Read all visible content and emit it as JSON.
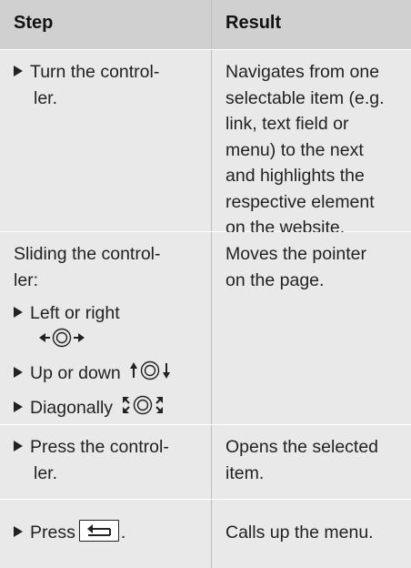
{
  "table": {
    "headers": [
      "Step",
      "Result"
    ],
    "rows": [
      {
        "step": [
          "Turn the control-",
          "ler."
        ],
        "result": [
          "Navigates from one",
          "selectable item (e.g.",
          "link, text field or",
          "menu) to the next",
          "and highlights the",
          "respective element",
          "on the website."
        ]
      },
      {
        "step_intro": [
          "Sliding the control-",
          "ler:"
        ],
        "bullets": [
          {
            "lines": [
              "Left or right"
            ],
            "icon": "left-right-slide-icon"
          },
          {
            "lines": [
              "Up or down"
            ],
            "icon": "up-down-slide-icon"
          },
          {
            "lines": [
              "Diagonally"
            ],
            "icon": "diagonal-slide-icon"
          }
        ],
        "result": [
          "Moves the pointer",
          "on the page."
        ]
      },
      {
        "step": [
          "Press the control-",
          "ler."
        ],
        "result": [
          "Opens the selected",
          "item."
        ]
      },
      {
        "step_prefix": "Press",
        "step_suffix": ".",
        "step_icon": "back-button-icon",
        "result": [
          "Calls up the menu."
        ]
      }
    ]
  }
}
